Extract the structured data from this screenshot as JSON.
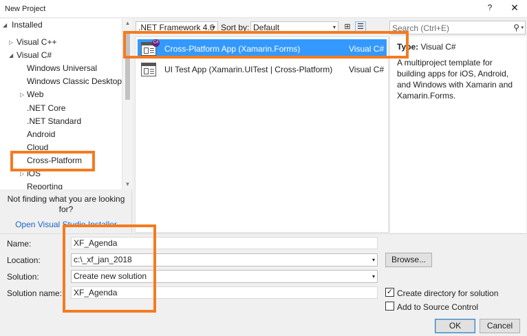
{
  "window": {
    "title": "New Project",
    "help": "?",
    "close": "✕"
  },
  "tree": {
    "items": [
      {
        "label": "Installed",
        "arrow": "◢"
      },
      {
        "label": "Visual C++",
        "arrow": "▷"
      },
      {
        "label": "Visual C#",
        "arrow": "◢"
      },
      {
        "label": "Windows Universal"
      },
      {
        "label": "Windows Classic Desktop"
      },
      {
        "label": "Web",
        "arrow": "▷"
      },
      {
        "label": ".NET Core"
      },
      {
        "label": ".NET Standard"
      },
      {
        "label": "Android"
      },
      {
        "label": "Cloud"
      },
      {
        "label": "Cross-Platform"
      },
      {
        "label": "iOS",
        "arrow": "▷"
      },
      {
        "label": "Reporting"
      }
    ],
    "scroll_up": "▲",
    "scroll_down": "▼"
  },
  "not_found": {
    "message": "Not finding what you are looking for?",
    "link": "Open Visual Studio Installer"
  },
  "toolbar": {
    "framework": ".NET Framework 4.6",
    "sort_label": "Sort by:",
    "sort_value": "Default",
    "caret": "▾",
    "grid_view_icon": "⊞",
    "list_view_icon": "☰"
  },
  "templates": [
    {
      "name": "Cross-Platform App (Xamarin.Forms)",
      "language": "Visual C#",
      "icon": "xamarin-forms-template-icon",
      "badge": "C#"
    },
    {
      "name": "UI Test App (Xamarin.UITest | Cross-Platform)",
      "language": "Visual C#",
      "icon": "uitest-template-icon"
    }
  ],
  "search": {
    "placeholder": "Search (Ctrl+E)",
    "icon": "⚲",
    "caret": "▾"
  },
  "description": {
    "type_label": "Type:",
    "type_value": "Visual C#",
    "text": "A multiproject template for building apps for iOS, Android, and Windows with Xamarin and Xamarin.Forms."
  },
  "form": {
    "name_label": "Name:",
    "name_value": "XF_Agenda",
    "location_label": "Location:",
    "location_value": "c:\\_xf_jan_2018",
    "browse": "Browse...",
    "solution_label": "Solution:",
    "solution_value": "Create new solution",
    "solution_name_label": "Solution name:",
    "solution_name_value": "XF_Agenda",
    "create_dir_label": "Create directory for solution",
    "create_dir_checked": true,
    "check_mark": "✓",
    "source_control_label": "Add to Source Control",
    "source_control_checked": false,
    "ok": "OK",
    "cancel": "Cancel"
  },
  "colors": {
    "highlight": "#f47b20",
    "selection": "#3399ff",
    "link": "#1a64c8"
  }
}
